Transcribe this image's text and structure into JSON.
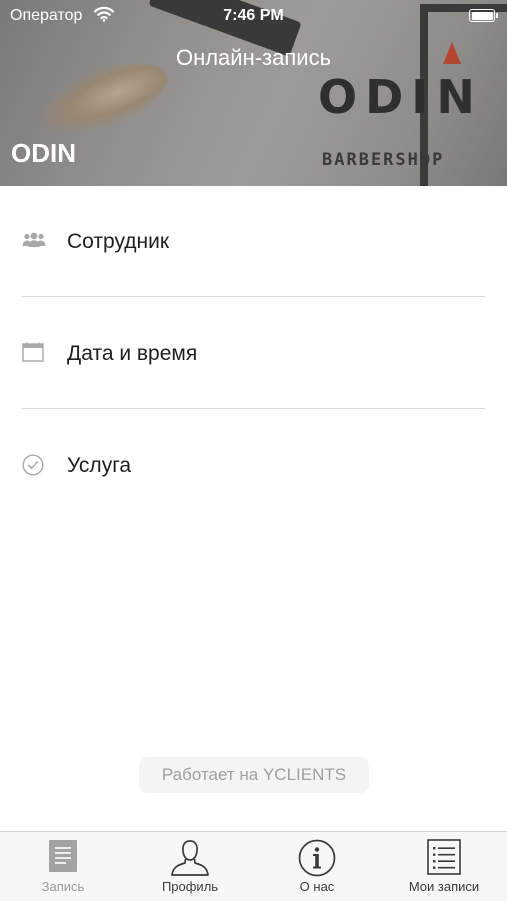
{
  "status_bar": {
    "carrier": "Оператор",
    "time": "7:46 PM"
  },
  "header": {
    "title": "Онлайн-запись",
    "company_name": "ODIN",
    "logo_text": "ODIN",
    "logo_subtext": "BARBERSHOP"
  },
  "menu": {
    "items": [
      {
        "label": "Сотрудник",
        "icon": "staff-icon"
      },
      {
        "label": "Дата и время",
        "icon": "calendar-icon"
      },
      {
        "label": "Услуга",
        "icon": "checkmark-circle-icon"
      }
    ]
  },
  "footer": {
    "powered_by": "Работает на YCLIENTS"
  },
  "tab_bar": {
    "tabs": [
      {
        "label": "Запись",
        "icon": "document-icon",
        "active": true
      },
      {
        "label": "Профиль",
        "icon": "person-icon",
        "active": false
      },
      {
        "label": "О нас",
        "icon": "info-icon",
        "active": false
      },
      {
        "label": "Мои записи",
        "icon": "list-icon",
        "active": false
      }
    ]
  },
  "colors": {
    "accent": "#b5462f",
    "active_tab": "#9b9b9b",
    "icon_gray": "#a8a8a8"
  }
}
